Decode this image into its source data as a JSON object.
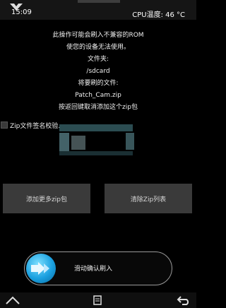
{
  "header": {
    "time": "15:09",
    "cpu_temp": "CPU温度: 46 °C",
    "logo_icon": "twrp-logo-icon"
  },
  "info_lines": [
    "此操作可能会刷入不兼容的ROM",
    "使您的设备无法使用。",
    "文件夹:",
    "/sdcard",
    "将要刷的文件:",
    "Patch_Cam.zip",
    "按返回键取消添加这个zip包"
  ],
  "zip_check": {
    "label": "Zip文件签名校验.",
    "checked": false
  },
  "buttons": {
    "add_more": "添加更多zip包",
    "clear_list": "清除Zip列表"
  },
  "slider": {
    "label": "滑动确认刷入",
    "knob_icon": "double-arrow-right-icon"
  },
  "navbar": {
    "home_icon": "home-icon",
    "menu_icon": "log-menu-icon",
    "back_icon": "back-arrow-icon"
  },
  "colors": {
    "background": "#000000",
    "button": "#3a3a3a",
    "accent": "#1aa0e0"
  }
}
